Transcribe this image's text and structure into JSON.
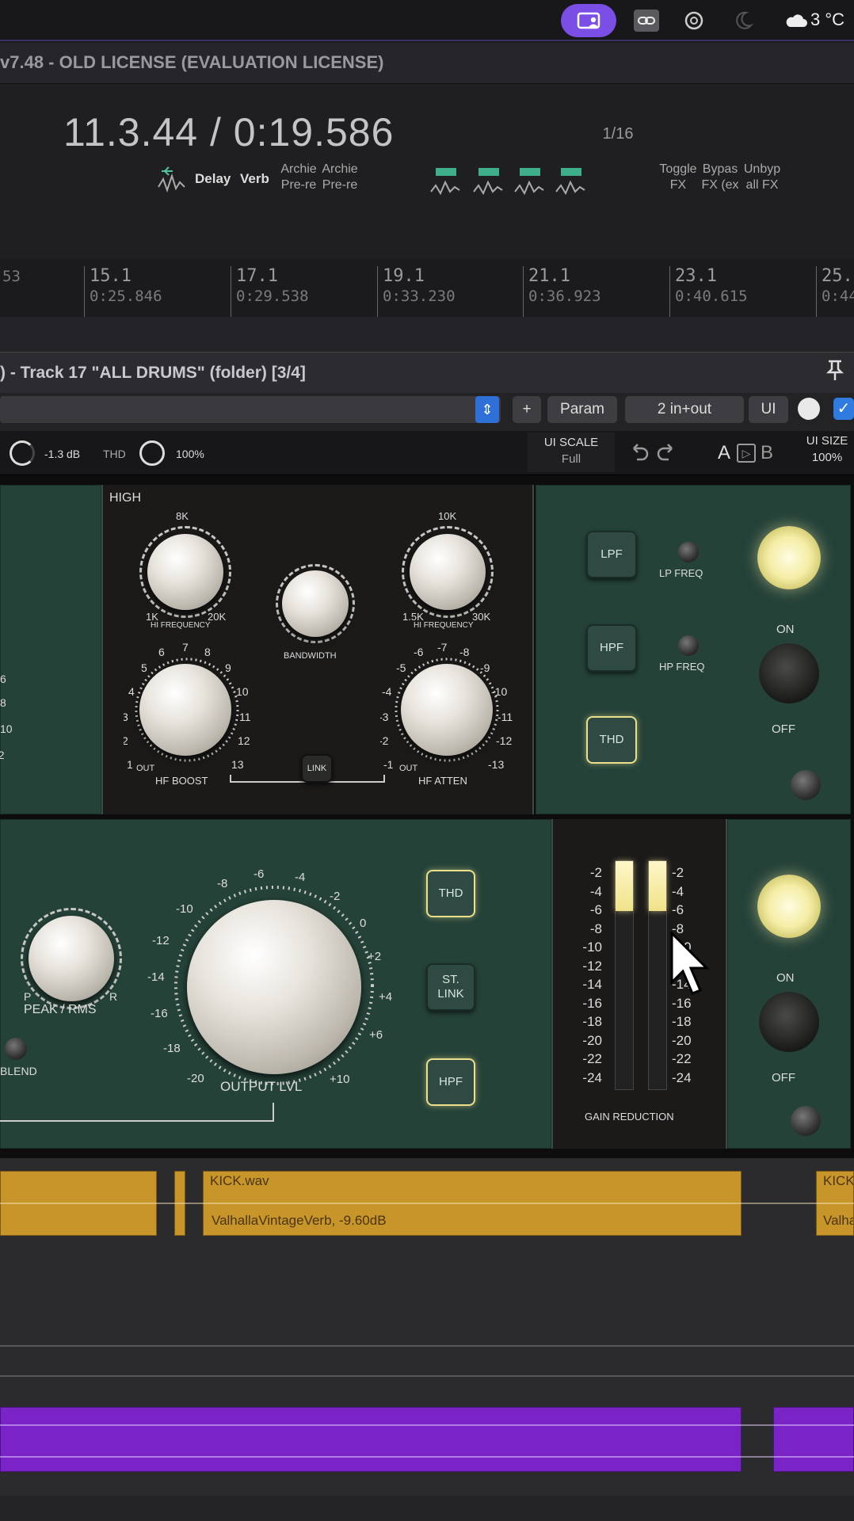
{
  "menubar": {
    "temperature": "3 °C"
  },
  "window": {
    "title": "v7.48 - OLD LICENSE (EVALUATION LICENSE)"
  },
  "transport": {
    "position": "11.3.44 / 0:19.586",
    "page": "1/16",
    "buttons": [
      {
        "label": "Delay"
      },
      {
        "label": "Verb"
      },
      {
        "label": "Archie Pre-re"
      },
      {
        "label": "Archie Pre-re"
      }
    ],
    "toggle_fx": "Toggle FX",
    "bypass_fx": "Bypas FX (ex",
    "unbypass_fx": "Unbyp all FX"
  },
  "ruler": {
    "marks": [
      {
        "bar": "",
        "time": "53"
      },
      {
        "bar": "15.1",
        "time": "0:25.846"
      },
      {
        "bar": "17.1",
        "time": "0:29.538"
      },
      {
        "bar": "19.1",
        "time": "0:33.230"
      },
      {
        "bar": "21.1",
        "time": "0:36.923"
      },
      {
        "bar": "23.1",
        "time": "0:40.615"
      },
      {
        "bar": "25.",
        "time": "0:44"
      }
    ]
  },
  "fx_window": {
    "title": ") - Track 17 \"ALL DRUMS\" (folder) [3/4]",
    "add_label": "+",
    "param_label": "Param",
    "io_label": "2 in+out",
    "ui_label": "UI"
  },
  "plugin_bar": {
    "gain_value": "-1.3 dB",
    "thd_label": "THD",
    "thd_value": "100%",
    "ui_scale_label": "UI SCALE",
    "ui_scale_value": "Full",
    "a_label": "A",
    "b_label": "B",
    "ui_size_label": "UI SIZE",
    "ui_size_value": "100%"
  },
  "eq_section": {
    "high_label": "HIGH",
    "hi_freq_1": {
      "top": "8K",
      "min": "1K",
      "max": "20K",
      "label": "HI FREQUENCY"
    },
    "bandwidth_label": "BANDWIDTH",
    "hi_freq_2": {
      "top": "10K",
      "min": "1.5K",
      "max": "30K",
      "label": "HI FREQUENCY"
    },
    "hf_boost_label": "HF BOOST",
    "hf_atten_label": "HF ATTEN",
    "out_label": "OUT",
    "link_label": "LINK",
    "lpf_label": "LPF",
    "lp_freq_label": "LP FREQ",
    "hpf_label": "HPF",
    "hp_freq_label": "HP FREQ",
    "thd_label": "THD",
    "on_label": "ON",
    "off_label": "OFF"
  },
  "comp_section": {
    "peak_rms_label": "PEAK / RMS",
    "p_label": "P",
    "r_label": "R",
    "blend_label": "BLEND",
    "output_lvl_label": "OUTPUT LVL",
    "output_scale": [
      "-20",
      "-18",
      "-16",
      "-14",
      "-12",
      "-10",
      "-8",
      "-6",
      "-4",
      "-2",
      "0",
      "+2",
      "+4",
      "+6",
      "+10"
    ],
    "thd_label": "THD",
    "st_link_label": "ST. LINK",
    "hpf_label": "HPF",
    "gain_reduction_label": "GAIN REDUCTION",
    "meter_scale": [
      "-2",
      "-4",
      "-6",
      "-8",
      "-10",
      "-12",
      "-14",
      "-16",
      "-18",
      "-20",
      "-22",
      "-24"
    ],
    "meter_levels": {
      "left": 0.22,
      "right": 0.22
    },
    "on_label": "ON",
    "off_label": "OFF"
  },
  "arrange": {
    "clip1_name": "KICK.wav",
    "clip1_fx": "ValhallaVintageVerb, -9.60dB",
    "clip2_name": "KICK",
    "clip2_fx": "Valha"
  },
  "colors": {
    "accent": "#7b4fe6",
    "clip_yellow": "#c8952a",
    "clip_purple": "#7a24c8",
    "panel_green": "#254239"
  }
}
